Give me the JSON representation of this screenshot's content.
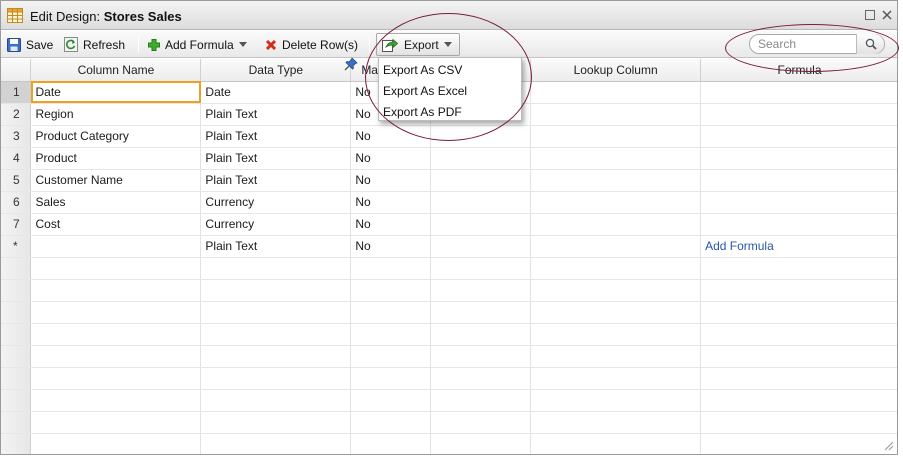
{
  "window": {
    "title_prefix": "Edit Design:",
    "title_name": "Stores Sales"
  },
  "toolbar": {
    "save_label": "Save",
    "refresh_label": "Refresh",
    "add_formula_label": "Add Formula",
    "delete_rows_label": "Delete Row(s)",
    "export_label": "Export"
  },
  "search": {
    "placeholder": "Search",
    "value": ""
  },
  "export_menu": {
    "items": [
      "Export As CSV",
      "Export As Excel",
      "Export As PDF"
    ]
  },
  "grid": {
    "columns": [
      "Column Name",
      "Data Type",
      "Ma",
      "",
      "Lookup Column",
      "Formula"
    ],
    "rows": [
      {
        "num": "1",
        "name": "Date",
        "type": "Date",
        "m": "No",
        "formula": ""
      },
      {
        "num": "2",
        "name": "Region",
        "type": "Plain Text",
        "m": "No",
        "formula": ""
      },
      {
        "num": "3",
        "name": "Product Category",
        "type": "Plain Text",
        "m": "No",
        "formula": ""
      },
      {
        "num": "4",
        "name": "Product",
        "type": "Plain Text",
        "m": "No",
        "formula": ""
      },
      {
        "num": "5",
        "name": "Customer Name",
        "type": "Plain Text",
        "m": "No",
        "formula": ""
      },
      {
        "num": "6",
        "name": "Sales",
        "type": "Currency",
        "m": "No",
        "formula": ""
      },
      {
        "num": "7",
        "name": "Cost",
        "type": "Currency",
        "m": "No",
        "formula": ""
      },
      {
        "num": "*",
        "name": "",
        "type": "Plain Text",
        "m": "No",
        "formula": "Add Formula"
      }
    ]
  },
  "colors": {
    "active_cell_border": "#f0a020",
    "link": "#2a56a4",
    "annotation_ellipse": "#7a1c3c"
  },
  "icons": {
    "title": "table-grid-icon",
    "save": "floppy-disk-icon",
    "refresh": "refresh-icon",
    "add_formula": "plus-icon",
    "delete_rows": "red-x-icon",
    "export": "export-arrow-icon",
    "search": "magnifier-icon",
    "pin": "pushpin-icon"
  }
}
